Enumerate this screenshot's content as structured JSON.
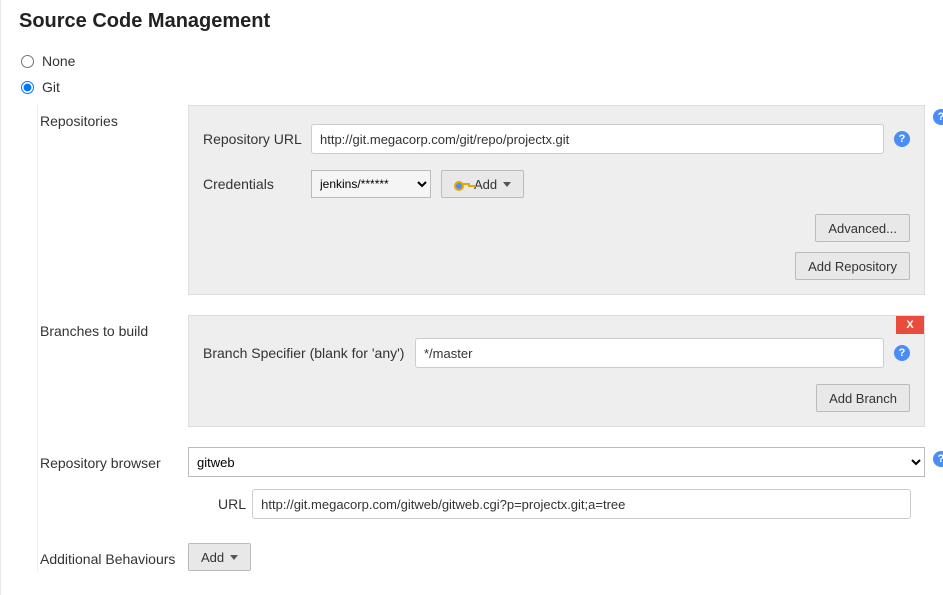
{
  "section_title": "Source Code Management",
  "scm_options": {
    "none_label": "None",
    "git_label": "Git",
    "selected": "git"
  },
  "repositories": {
    "label": "Repositories",
    "repo_url_label": "Repository URL",
    "repo_url_value": "http://git.megacorp.com/git/repo/projectx.git",
    "credentials_label": "Credentials",
    "credentials_selected": "jenkins/******",
    "add_cred_label": "Add",
    "advanced_label": "Advanced...",
    "add_repo_label": "Add Repository"
  },
  "branches": {
    "label": "Branches to build",
    "specifier_label": "Branch Specifier (blank for 'any')",
    "specifier_value": "*/master",
    "delete_label": "X",
    "add_branch_label": "Add Branch"
  },
  "browser": {
    "label": "Repository browser",
    "selected": "gitweb",
    "url_label": "URL",
    "url_value": "http://git.megacorp.com/gitweb/gitweb.cgi?p=projectx.git;a=tree"
  },
  "behaviours": {
    "label": "Additional Behaviours",
    "add_label": "Add"
  }
}
